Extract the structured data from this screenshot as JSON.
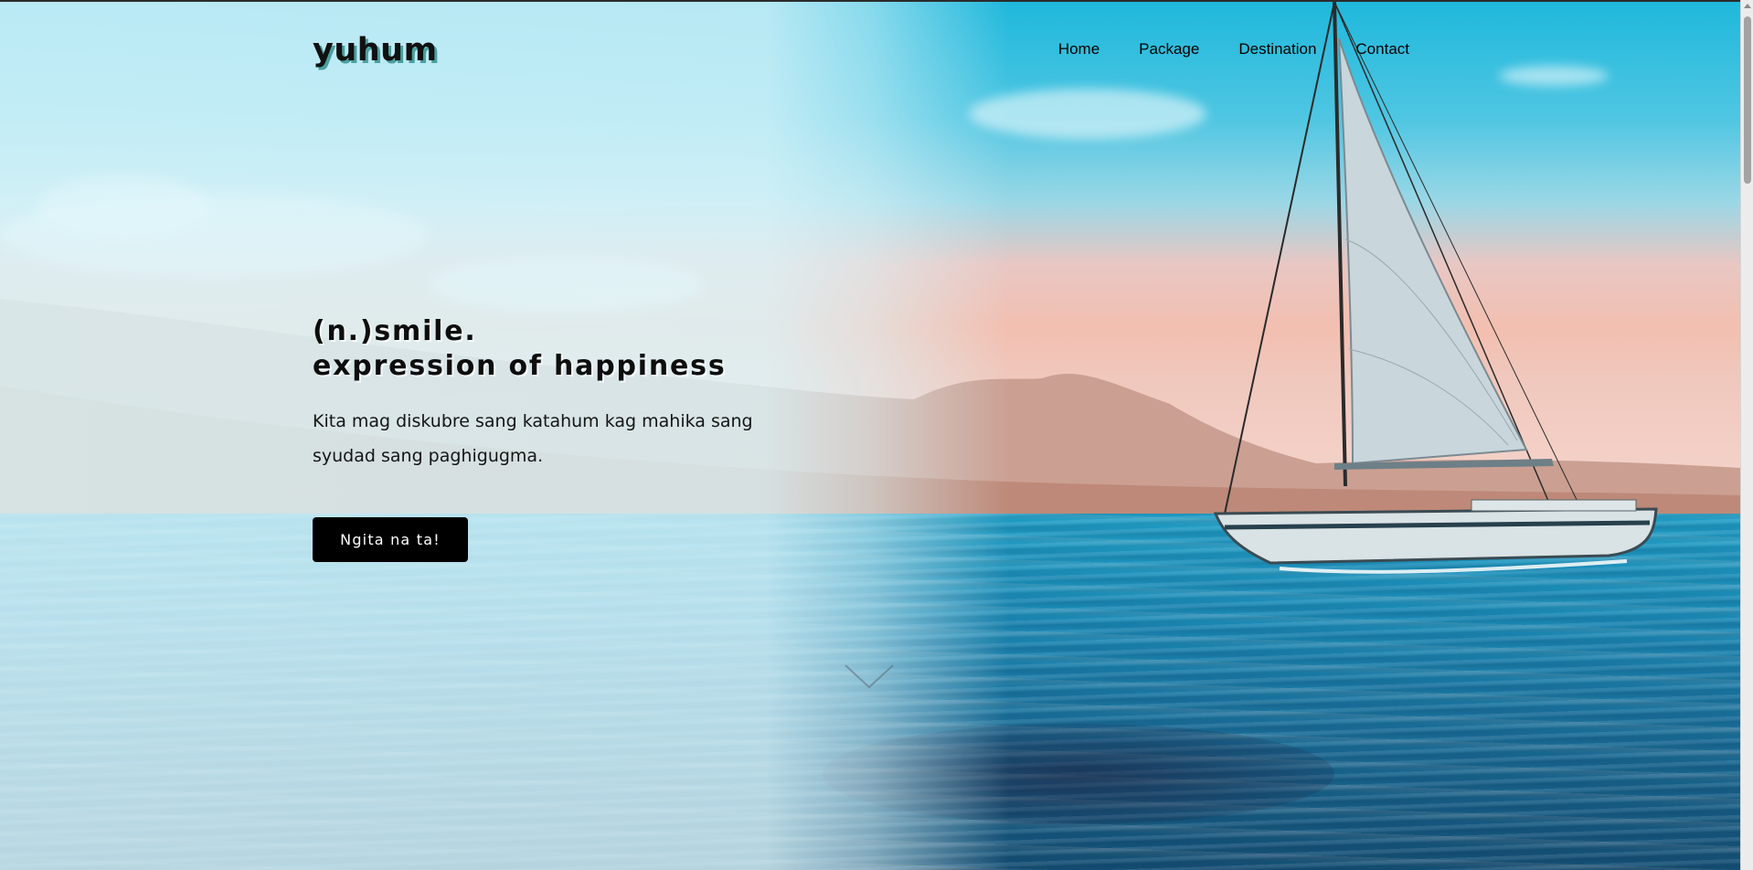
{
  "site": {
    "logo": "yuhum"
  },
  "nav": {
    "items": [
      "Home",
      "Package",
      "Destination",
      "Contact"
    ]
  },
  "hero": {
    "title_line1": "(n.)smile.",
    "title_line2": "expression of happiness",
    "subtitle_line1": "Kita mag diskubre sang katahum kag mahika sang",
    "subtitle_line2": "syudad sang paghigugma.",
    "cta_label": "Ngita na ta!"
  },
  "icons": {
    "scroll_down": "chevron-down-icon"
  },
  "colors": {
    "accent": "#000000",
    "logo_shadow": "#4a9f9f",
    "sea": "#1a8ab6",
    "sky": "#1fb8dc"
  }
}
